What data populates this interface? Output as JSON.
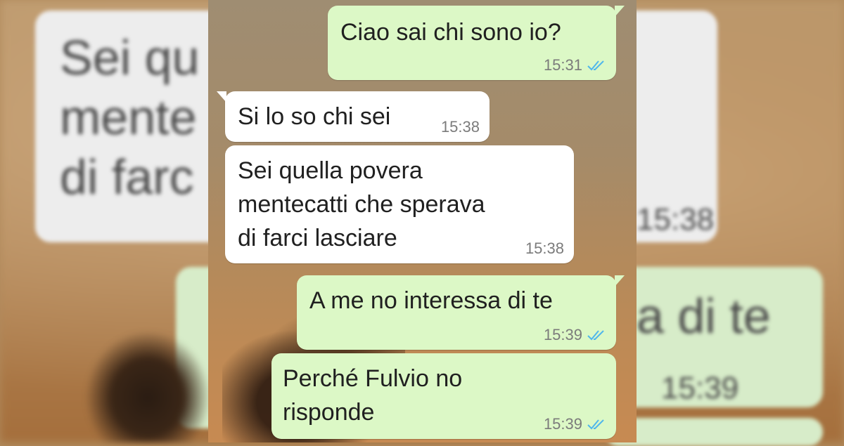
{
  "colors": {
    "outgoing_bubble": "#dcf8c6",
    "incoming_bubble": "#ffffff",
    "read_ticks": "#4fb6ec",
    "timestamp": "#7b7b7b"
  },
  "background_ghost_text": {
    "left": "Sei qu\nmente\ndi farc",
    "right_time_1": "15:38",
    "right_text": "a di te",
    "right_time_2": "15:39"
  },
  "messages": [
    {
      "direction": "outgoing",
      "text": "Ciao sai chi sono io?",
      "time": "15:31",
      "status_icon": "double-check-read-icon"
    },
    {
      "direction": "incoming",
      "text": "Si lo so chi sei",
      "time": "15:38"
    },
    {
      "direction": "incoming",
      "text": "Sei quella povera\nmentecatti che sperava\ndi farci lasciare",
      "time": "15:38"
    },
    {
      "direction": "outgoing",
      "text": "A me no interessa di te",
      "time": "15:39",
      "status_icon": "double-check-read-icon"
    },
    {
      "direction": "outgoing",
      "text": "Perché Fulvio no\nrisponde",
      "time": "15:39",
      "status_icon": "double-check-read-icon"
    }
  ]
}
